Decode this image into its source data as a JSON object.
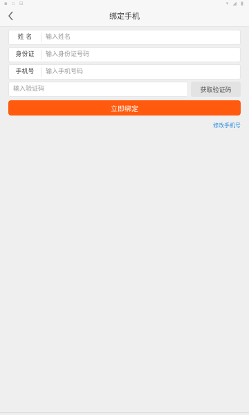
{
  "status_bar": {
    "left_text": "▪ ▫ ⊟",
    "right_text": "▾ ◢ ▮"
  },
  "header": {
    "back_icon": "chevron-left-icon",
    "title": "绑定手机"
  },
  "form": {
    "name_label": "姓 名",
    "name_placeholder": "输入姓名",
    "id_label": "身份证",
    "id_placeholder": "输入身份证号码",
    "phone_label": "手机号",
    "phone_placeholder": "输入手机号码",
    "code_placeholder": "输入验证码",
    "get_code_label": "获取验证码"
  },
  "actions": {
    "submit_label": "立即绑定",
    "modify_phone_label": "修改手机号"
  },
  "colors": {
    "accent": "#ff5a0e",
    "link": "#2a8ee0"
  }
}
